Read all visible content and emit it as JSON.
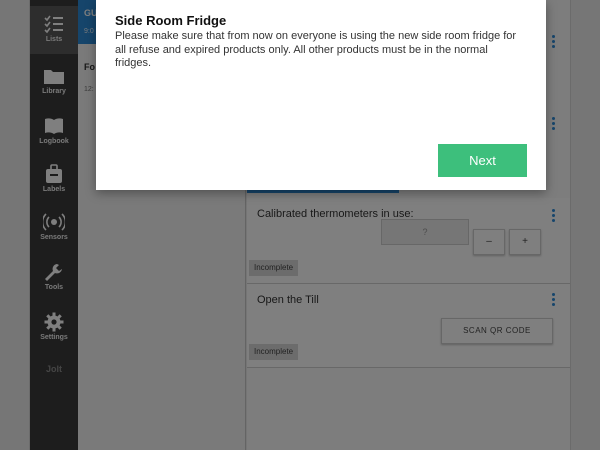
{
  "sidebar": {
    "items": [
      {
        "label": "Lists",
        "icon": "checklist-icon"
      },
      {
        "label": "Library",
        "icon": "folder-icon"
      },
      {
        "label": "Logbook",
        "icon": "book-icon"
      },
      {
        "label": "Labels",
        "icon": "label-icon"
      },
      {
        "label": "Sensors",
        "icon": "sensor-icon"
      },
      {
        "label": "Tools",
        "icon": "wrench-icon"
      },
      {
        "label": "Settings",
        "icon": "gear-icon"
      }
    ],
    "brand": "Jolt"
  },
  "list_panel": {
    "header_title": "GU",
    "header_sub": "9:0",
    "entry_title": "Fo",
    "entry_sub": "12:"
  },
  "main": {
    "progress_fraction": 0.47,
    "tasks": [
      {
        "title": "Calibrated thermometers in use:",
        "input_placeholder": "?",
        "minus_label": "–",
        "plus_label": "+",
        "status": "Incomplete"
      },
      {
        "title": "Open the Till",
        "button_label": "SCAN QR CODE",
        "status": "Incomplete"
      }
    ]
  },
  "modal": {
    "title": "Side Room Fridge",
    "body": "Please make sure that from now on everyone is using the new side room fridge for all refuse and expired products only. All other products must be in the normal fridges.",
    "next_label": "Next"
  },
  "colors": {
    "accent": "#2d8ad6",
    "next_button": "#3dbf7c",
    "sidebar": "#3a3a3a"
  }
}
